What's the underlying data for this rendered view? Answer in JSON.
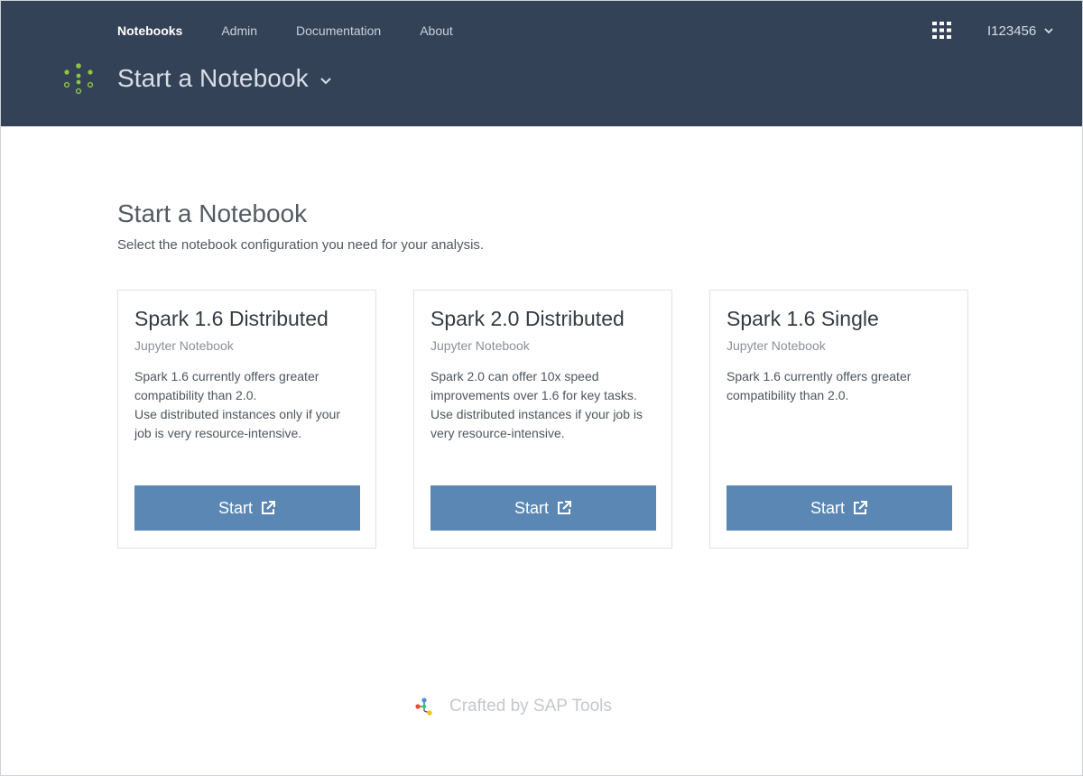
{
  "nav": {
    "items": [
      {
        "label": "Notebooks",
        "active": true
      },
      {
        "label": "Admin",
        "active": false
      },
      {
        "label": "Documentation",
        "active": false
      },
      {
        "label": "About",
        "active": false
      }
    ]
  },
  "user": {
    "id": "I123456"
  },
  "header": {
    "page_title": "Start a Notebook"
  },
  "main": {
    "title": "Start a Notebook",
    "subtitle": "Select the notebook configuration you need for your analysis."
  },
  "cards": [
    {
      "title": "Spark 1.6 Distributed",
      "type": "Jupyter Notebook",
      "desc": [
        "Spark 1.6 currently offers greater",
        "compatibility than 2.0.",
        "Use distributed instances only if your",
        "job is very resource-intensive."
      ],
      "button": "Start"
    },
    {
      "title": "Spark 2.0 Distributed",
      "type": "Jupyter Notebook",
      "desc": [
        "Spark 2.0 can offer 10x speed",
        "improvements over 1.6 for key tasks.",
        "Use distributed instances if your job is",
        "very resource-intensive."
      ],
      "button": "Start"
    },
    {
      "title": "Spark 1.6 Single",
      "type": "Jupyter Notebook",
      "desc": [
        "Spark 1.6 currently offers greater",
        "compatibility than 2.0."
      ],
      "button": "Start"
    }
  ],
  "footer": {
    "text": "Crafted by SAP Tools"
  },
  "icons": {
    "logo": "dotted-circle-logo-icon",
    "apps": "app-grid-icon",
    "user_chevron": "chevron-down-icon",
    "title_chevron": "chevron-down-icon",
    "start": "external-link-icon",
    "footer": "sap-tools-logo-icon"
  },
  "colors": {
    "header_bg": "#344258",
    "button_bg": "#5b87b4",
    "logo_green": "#8cc63f"
  }
}
